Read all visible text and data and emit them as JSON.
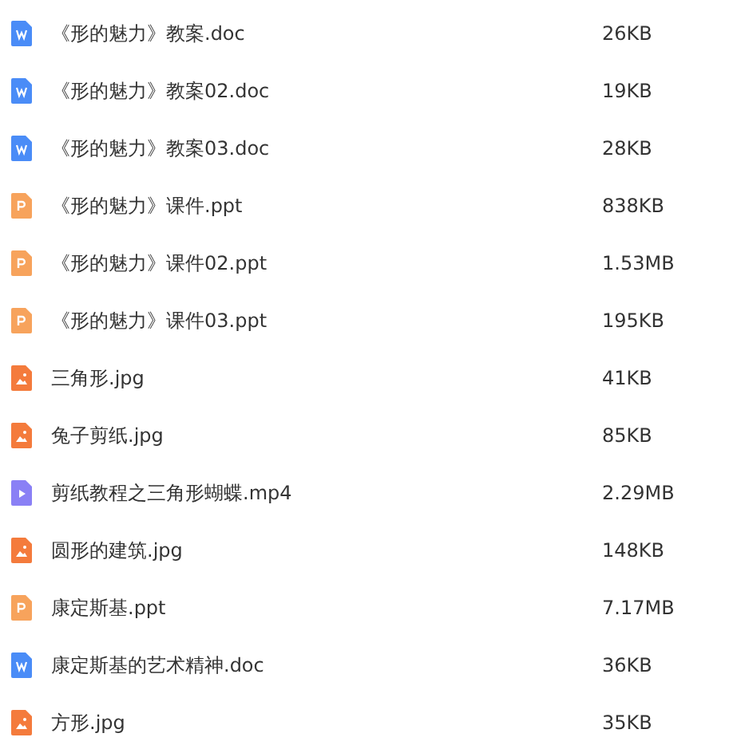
{
  "files": [
    {
      "kind": "doc",
      "name": "《形的魅力》教案.doc",
      "size": "26KB"
    },
    {
      "kind": "doc",
      "name": "《形的魅力》教案02.doc",
      "size": "19KB"
    },
    {
      "kind": "doc",
      "name": "《形的魅力》教案03.doc",
      "size": "28KB"
    },
    {
      "kind": "ppt",
      "name": "《形的魅力》课件.ppt",
      "size": "838KB"
    },
    {
      "kind": "ppt",
      "name": "《形的魅力》课件02.ppt",
      "size": "1.53MB"
    },
    {
      "kind": "ppt",
      "name": "《形的魅力》课件03.ppt",
      "size": "195KB"
    },
    {
      "kind": "image",
      "name": "三角形.jpg",
      "size": "41KB"
    },
    {
      "kind": "image",
      "name": "兔子剪纸.jpg",
      "size": "85KB"
    },
    {
      "kind": "video",
      "name": "剪纸教程之三角形蝴蝶.mp4",
      "size": "2.29MB"
    },
    {
      "kind": "image",
      "name": "圆形的建筑.jpg",
      "size": "148KB"
    },
    {
      "kind": "ppt",
      "name": "康定斯基.ppt",
      "size": "7.17MB"
    },
    {
      "kind": "doc",
      "name": "康定斯基的艺术精神.doc",
      "size": "36KB"
    },
    {
      "kind": "image",
      "name": "方形.jpg",
      "size": "35KB"
    }
  ]
}
